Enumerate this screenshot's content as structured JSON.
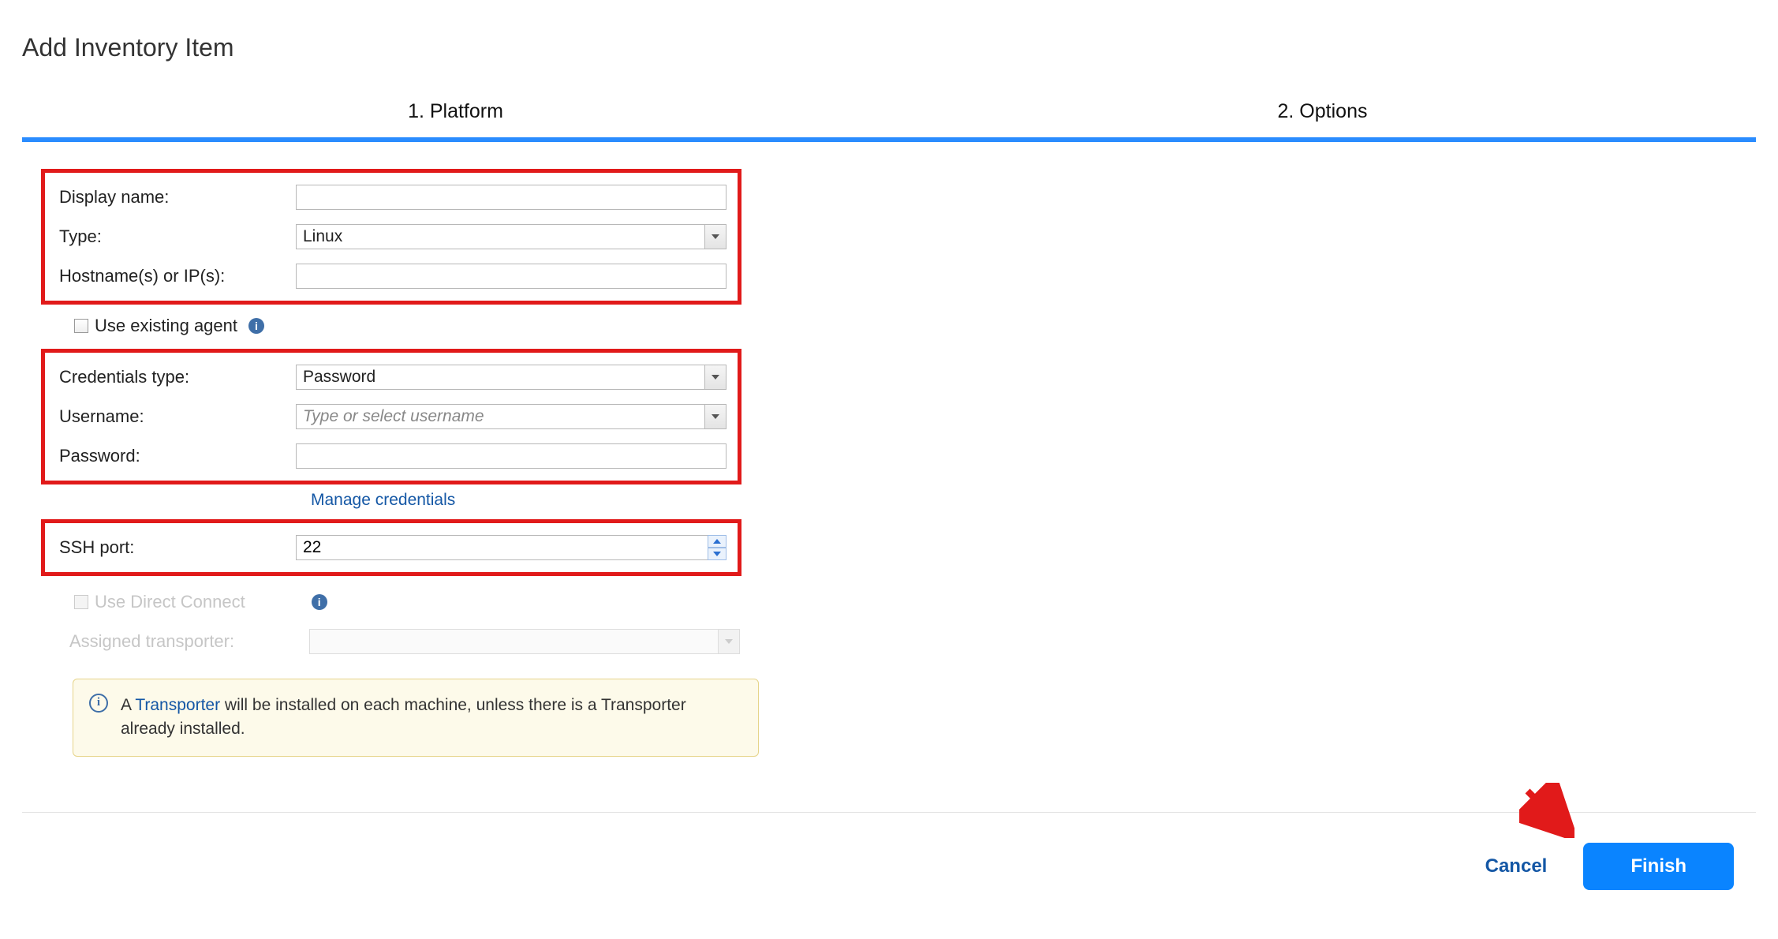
{
  "title": "Add Inventory Item",
  "tabs": {
    "platform": "1. Platform",
    "options": "2. Options"
  },
  "labels": {
    "display_name": "Display name:",
    "type": "Type:",
    "hostname": "Hostname(s) or IP(s):",
    "use_existing_agent": "Use existing agent",
    "credentials_type": "Credentials type:",
    "username": "Username:",
    "password": "Password:",
    "ssh_port": "SSH port:",
    "use_direct_connect": "Use Direct Connect",
    "assigned_transporter": "Assigned transporter:"
  },
  "values": {
    "display_name": "",
    "type": "Linux",
    "hostname": "",
    "credentials_type": "Password",
    "username": "",
    "username_placeholder": "Type or select username",
    "password": "",
    "ssh_port": "22",
    "assigned_transporter": ""
  },
  "links": {
    "manage_credentials": "Manage credentials",
    "transporter": "Transporter"
  },
  "info_panel": {
    "before": "A ",
    "after": " will be installed on each machine, unless there is a Transporter already installed."
  },
  "buttons": {
    "cancel": "Cancel",
    "finish": "Finish"
  },
  "icons": {
    "info": "i"
  }
}
